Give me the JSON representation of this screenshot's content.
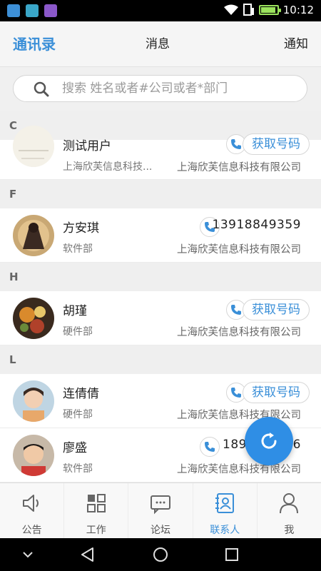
{
  "status_bar": {
    "time": "10:12",
    "battery_level": 0.9
  },
  "top_tabs": [
    {
      "label": "通讯录",
      "active": true
    },
    {
      "label": "消息",
      "active": false
    },
    {
      "label": "通知",
      "active": false
    }
  ],
  "search": {
    "placeholder": "搜索 姓名或者#公司或者*部门"
  },
  "sections": [
    {
      "letter": "C"
    },
    {
      "letter": "F"
    },
    {
      "letter": "H"
    },
    {
      "letter": "L"
    }
  ],
  "contacts": [
    {
      "name": "测试用户",
      "dept": "上海欣芙信息科技...",
      "company": "上海欣芙信息科技有限公司",
      "action": "获取号码"
    },
    {
      "name": "方安琪",
      "dept": "软件部",
      "company": "上海欣芙信息科技有限公司",
      "phone": "13918849359"
    },
    {
      "name": "胡瑾",
      "dept": "硬件部",
      "company": "上海欣芙信息科技有限公司",
      "action": "获取号码"
    },
    {
      "name": "连倩倩",
      "dept": "硬件部",
      "company": "上海欣芙信息科技有限公司",
      "action": "获取号码"
    },
    {
      "name": "廖盛",
      "dept": "软件部",
      "company": "上海欣芙信息科技有限公司",
      "phone_left": "189",
      "phone_right": "6"
    }
  ],
  "bottom_nav": [
    {
      "label": "公告",
      "icon": "speaker-icon",
      "active": false
    },
    {
      "label": "工作",
      "icon": "grid-icon",
      "active": false
    },
    {
      "label": "论坛",
      "icon": "chat-icon",
      "active": false
    },
    {
      "label": "联系人",
      "icon": "contact-card-icon",
      "active": true
    },
    {
      "label": "我",
      "icon": "person-icon",
      "active": false
    }
  ],
  "colors": {
    "accent": "#3a8fd8",
    "fab": "#2f8ee5",
    "section_bg": "#efefef"
  }
}
